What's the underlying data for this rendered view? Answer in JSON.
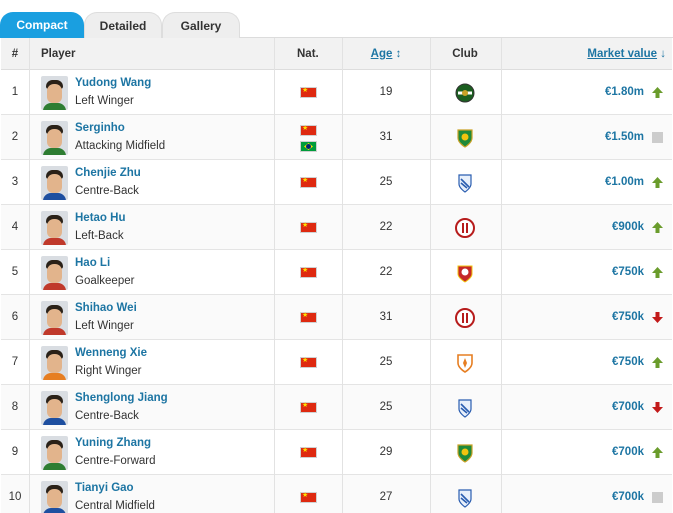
{
  "tabs": [
    {
      "label": "Compact",
      "active": true
    },
    {
      "label": "Detailed",
      "active": false
    },
    {
      "label": "Gallery",
      "active": false
    }
  ],
  "columns": {
    "num": "#",
    "player": "Player",
    "nat": "Nat.",
    "age": "Age",
    "age_sort_icon": "sort-icon",
    "club": "Club",
    "market_value": "Market value",
    "market_value_sort_icon": "sort-desc-icon"
  },
  "colors": {
    "tab_active": "#1a9fe0",
    "link": "#1d75a3",
    "trend_up": "#6a9c2c",
    "trend_down": "#c21a1a",
    "trend_same": "#cccccc"
  },
  "players": [
    {
      "num": "1",
      "name": "Yudong Wang",
      "position": "Left Winger",
      "nationality": [
        "China"
      ],
      "age": "19",
      "club_icon": "club-badge-green-round",
      "market_value": "€1.80m",
      "trend": "up"
    },
    {
      "num": "2",
      "name": "Serginho",
      "position": "Attacking Midfield",
      "nationality": [
        "China",
        "Brazil"
      ],
      "age": "31",
      "club_icon": "club-badge-green-shield",
      "market_value": "€1.50m",
      "trend": "same"
    },
    {
      "num": "3",
      "name": "Chenjie Zhu",
      "position": "Centre-Back",
      "nationality": [
        "China"
      ],
      "age": "25",
      "club_icon": "club-badge-blue-shield",
      "market_value": "€1.00m",
      "trend": "up"
    },
    {
      "num": "4",
      "name": "Hetao Hu",
      "position": "Left-Back",
      "nationality": [
        "China"
      ],
      "age": "22",
      "club_icon": "club-badge-red-round",
      "market_value": "€900k",
      "trend": "up"
    },
    {
      "num": "5",
      "name": "Hao Li",
      "position": "Goalkeeper",
      "nationality": [
        "China"
      ],
      "age": "22",
      "club_icon": "club-badge-red-shield",
      "market_value": "€750k",
      "trend": "up"
    },
    {
      "num": "6",
      "name": "Shihao Wei",
      "position": "Left Winger",
      "nationality": [
        "China"
      ],
      "age": "31",
      "club_icon": "club-badge-red-round",
      "market_value": "€750k",
      "trend": "down"
    },
    {
      "num": "7",
      "name": "Wenneng Xie",
      "position": "Right Winger",
      "nationality": [
        "China"
      ],
      "age": "25",
      "club_icon": "club-badge-orange-shield",
      "market_value": "€750k",
      "trend": "up"
    },
    {
      "num": "8",
      "name": "Shenglong Jiang",
      "position": "Centre-Back",
      "nationality": [
        "China"
      ],
      "age": "25",
      "club_icon": "club-badge-blue-shield",
      "market_value": "€700k",
      "trend": "down"
    },
    {
      "num": "9",
      "name": "Yuning Zhang",
      "position": "Centre-Forward",
      "nationality": [
        "China"
      ],
      "age": "29",
      "club_icon": "club-badge-green-shield",
      "market_value": "€700k",
      "trend": "up"
    },
    {
      "num": "10",
      "name": "Tianyi Gao",
      "position": "Central Midfield",
      "nationality": [
        "China"
      ],
      "age": "27",
      "club_icon": "club-badge-blue-shield",
      "market_value": "€700k",
      "trend": "same"
    }
  ]
}
